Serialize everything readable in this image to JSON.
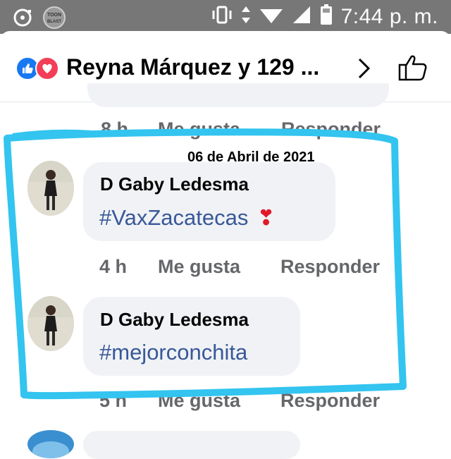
{
  "status_bar": {
    "time": "7:44 p. m.",
    "icons": [
      "cd-icon",
      "toon-blast-icon",
      "vibrate-icon",
      "data-arrows-icon",
      "wifi-icon",
      "signal-icon",
      "battery-icon"
    ],
    "app_badge": "TOON BLAST"
  },
  "header": {
    "reactions": [
      "like-icon",
      "love-icon"
    ],
    "title": "Reyna Márquez y 129 ...",
    "actions": [
      "chevron-right-icon",
      "thumbs-up-icon"
    ]
  },
  "annotation": {
    "date": "06 de Abril de 2021",
    "highlight_color": "#33c4ef"
  },
  "partial_top": {
    "time": "8 h",
    "like": "Me gusta",
    "reply": "Responder"
  },
  "comments": [
    {
      "author": "D Gaby Ledesma",
      "text": "#VaxZacatecas",
      "emoji": "❣️",
      "time": "4 h",
      "like": "Me gusta",
      "reply": "Responder"
    },
    {
      "author": "D Gaby Ledesma",
      "text": "#mejorconchita",
      "time": "5 h",
      "like": "Me gusta",
      "reply": "Responder"
    }
  ],
  "colors": {
    "status_bar_bg": "#777777",
    "link_blue": "#385898",
    "bubble_bg": "#f0f2f5",
    "meta_gray": "#65676b",
    "like_blue": "#1877f2",
    "love_red": "#f33e58"
  }
}
